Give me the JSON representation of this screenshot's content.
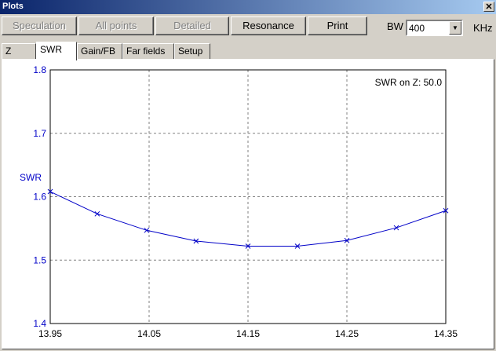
{
  "window": {
    "title": "Plots"
  },
  "toolbar": {
    "buttons": [
      {
        "label": "Speculation",
        "enabled": false
      },
      {
        "label": "All points",
        "enabled": false
      },
      {
        "label": "Detailed",
        "enabled": false
      },
      {
        "label": "Resonance",
        "enabled": true
      },
      {
        "label": "Print",
        "enabled": true
      }
    ],
    "bw_label": "BW",
    "bw_value": "400",
    "bw_unit": "KHz"
  },
  "tabs": [
    {
      "label": "Z",
      "active": false
    },
    {
      "label": "SWR",
      "active": true
    },
    {
      "label": "Gain/FB",
      "active": false
    },
    {
      "label": "Far fields",
      "active": false
    },
    {
      "label": "Setup",
      "active": false
    }
  ],
  "colors": {
    "series": "#0000c8",
    "axis_labels": "#0000c8",
    "grid": "#808080"
  },
  "chart_data": {
    "type": "line",
    "ylabel": "SWR",
    "annotation": "SWR on Z: 50.0",
    "xlim": [
      13.95,
      14.35
    ],
    "ylim": [
      1.4,
      1.8
    ],
    "x_ticks": [
      "13.95",
      "14.05",
      "14.15",
      "14.25",
      "14.35"
    ],
    "y_ticks": [
      "1.4",
      "1.5",
      "1.6",
      "1.7",
      "1.8"
    ],
    "grid": true,
    "series": [
      {
        "x": [
          13.95,
          13.9975,
          14.0475,
          14.0975,
          14.15,
          14.2,
          14.25,
          14.3,
          14.35
        ],
        "y": [
          1.608,
          1.573,
          1.547,
          1.53,
          1.522,
          1.522,
          1.531,
          1.551,
          1.578
        ],
        "marker": "x"
      }
    ]
  }
}
